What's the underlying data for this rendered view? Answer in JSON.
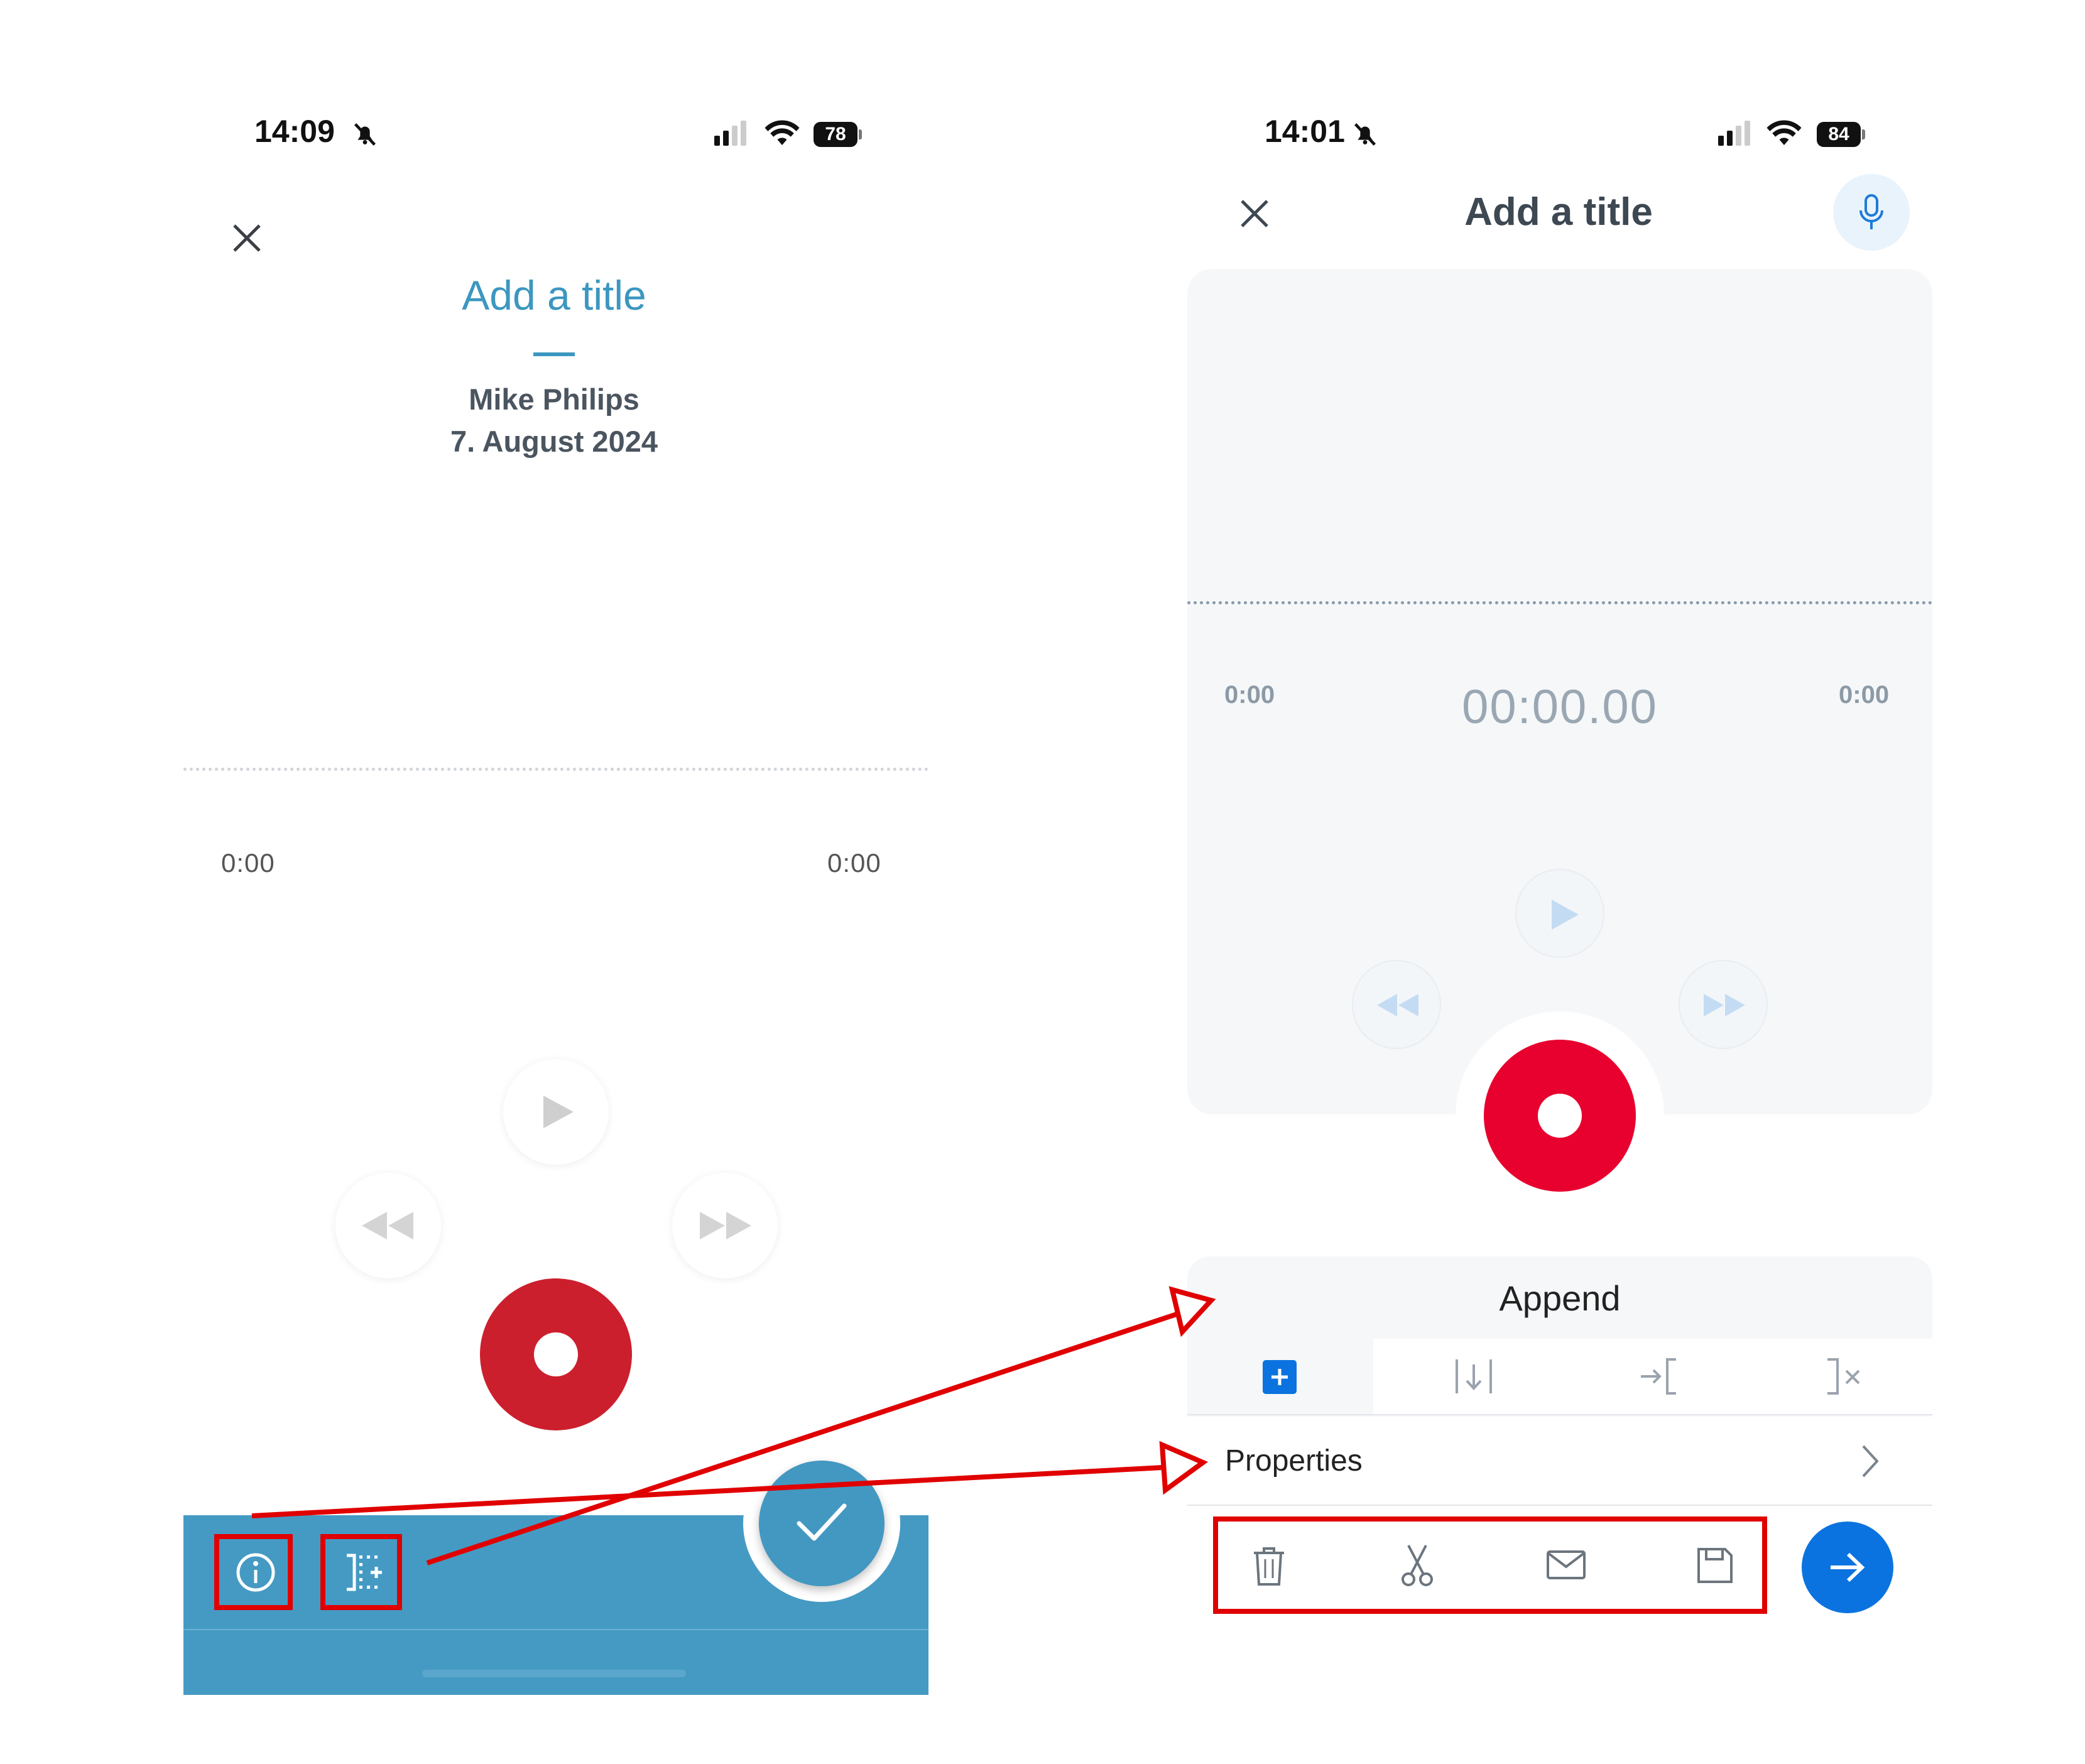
{
  "left": {
    "status": {
      "time": "14:09",
      "battery": "78"
    },
    "title": "Add a title",
    "author": "Mike Philips",
    "date": "7. August 2024",
    "time_start": "0:00",
    "time_end": "0:00",
    "icons": {
      "close": "close-icon",
      "play": "play-icon",
      "rewind": "rewind-icon",
      "forward": "fast-forward-icon",
      "record": "record-icon",
      "info": "info-icon",
      "append": "append-icon",
      "check": "check-icon"
    }
  },
  "right": {
    "status": {
      "time": "14:01",
      "battery": "84"
    },
    "title": "Add a title",
    "time_start": "0:00",
    "counter": "00:00.00",
    "time_end": "0:00",
    "mode_label": "Append",
    "mode_tabs": [
      "append",
      "insert",
      "overwrite-from",
      "delete-to-end"
    ],
    "properties_label": "Properties",
    "actions": [
      "delete",
      "cut",
      "email",
      "save"
    ],
    "icons": {
      "close": "close-icon",
      "microphone": "microphone-icon",
      "next": "arrow-right-icon",
      "chevron": "chevron-right-icon"
    }
  },
  "colors": {
    "accent_left": "#3c97c0",
    "bar_left": "#459ac3",
    "record_left": "#cc1f2e",
    "record_right": "#e8002e",
    "primary_right": "#0b73df",
    "annotation_red": "#e00000"
  }
}
